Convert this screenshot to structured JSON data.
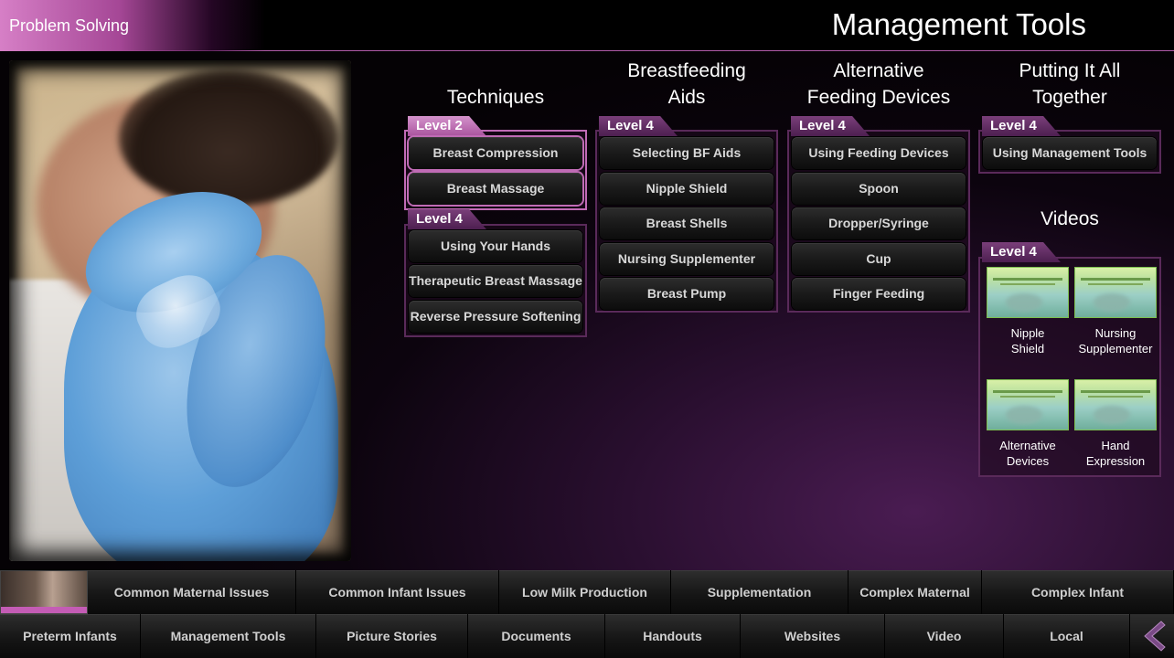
{
  "header": {
    "section": "Problem Solving",
    "title": "Management Tools"
  },
  "columns": {
    "techniques": {
      "heading": "Techniques",
      "groups": [
        {
          "level": "Level 2",
          "items": [
            "Breast Compression",
            "Breast Massage"
          ]
        },
        {
          "level": "Level 4",
          "items": [
            "Using Your Hands",
            "Therapeutic Breast Massage",
            "Reverse Pressure Softening"
          ]
        }
      ]
    },
    "aids": {
      "heading_line1": "Breastfeeding",
      "heading_line2": "Aids",
      "level": "Level 4",
      "items": [
        "Selecting BF Aids",
        "Nipple Shield",
        "Breast Shells",
        "Nursing Supplementer",
        "Breast Pump"
      ]
    },
    "devices": {
      "heading_line1": "Alternative",
      "heading_line2": "Feeding Devices",
      "level": "Level 4",
      "items": [
        "Using Feeding Devices",
        "Spoon",
        "Dropper/Syringe",
        "Cup",
        "Finger Feeding"
      ]
    },
    "together": {
      "heading_line1": "Putting It All",
      "heading_line2": "Together",
      "level": "Level 4",
      "items": [
        "Using Management Tools"
      ]
    },
    "videos": {
      "heading": "Videos",
      "level": "Level 4",
      "items": [
        {
          "line1": "Nipple",
          "line2": "Shield"
        },
        {
          "line1": "Nursing",
          "line2": "Supplementer"
        },
        {
          "line1": "Alternative",
          "line2": "Devices"
        },
        {
          "line1": "Hand",
          "line2": "Expression"
        }
      ]
    }
  },
  "nav": {
    "row1": [
      "Common Maternal Issues",
      "Common Infant Issues",
      "Low Milk Production",
      "Supplementation",
      "Complex Maternal",
      "Complex Infant"
    ],
    "row2": [
      "Preterm Infants",
      "Management Tools",
      "Picture Stories",
      "Documents",
      "Handouts",
      "Websites",
      "Video",
      "Local"
    ]
  },
  "icons": {
    "back": "chevron-left-icon"
  },
  "colors": {
    "accent": "#c06bb5",
    "section_tag": "#a54796"
  }
}
